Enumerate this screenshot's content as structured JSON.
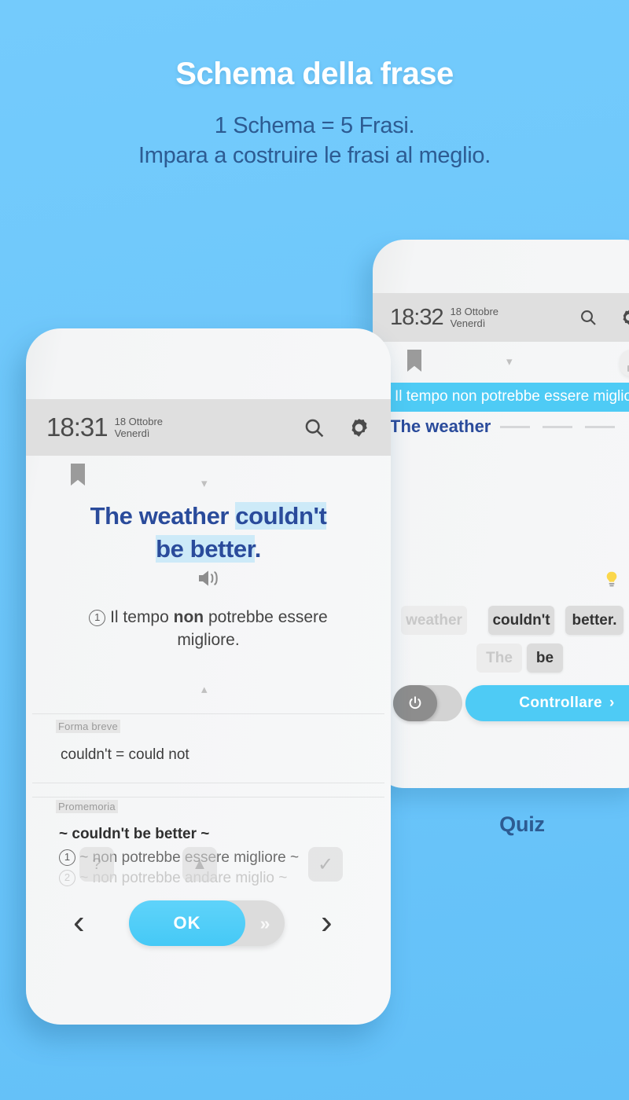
{
  "page": {
    "headline": "Schema della frase",
    "subline_1": "1 Schema = 5 Frasi.",
    "subline_2": "Impara a costruire le frasi al meglio.",
    "bg_color": "#6ec8fb",
    "accent_color": "#4ecbf5",
    "heading_text_color": "#ffffff",
    "sub_text_color": "#2d5b92"
  },
  "phone_front": {
    "status_bar": {
      "time": "18:31",
      "date_day": "18 Ottobre",
      "date_weekday": "Venerdì",
      "search_icon": "search-icon",
      "settings_icon": "gear-icon"
    },
    "bookmark_icon": "bookmark-icon",
    "collapse_icon": "chevron-down-icon",
    "sentence": {
      "plain_start": "The weather ",
      "highlight_1": "couldn't",
      "highlight_2": "be better",
      "period": ".",
      "text_color": "#2a4b9b",
      "highlight_color": "#cdeaf8"
    },
    "speaker_icon": "speaker-icon",
    "translation": {
      "number": "1",
      "part_1": "Il tempo ",
      "bold": "non",
      "part_2": " potrebbe essere migliore."
    },
    "expand_icon": "chevron-up-icon",
    "short_form_panel": {
      "label": "Forma breve",
      "body": "couldn't = could not"
    },
    "memo_panel": {
      "label": "Promemoria",
      "heading": "~ couldn't be better ~",
      "items": [
        {
          "number": "1",
          "text": "~ non potrebbe essere migliore ~"
        },
        {
          "number": "2",
          "text": "~ non potrebbe andare miglio ~"
        }
      ],
      "overlay_hint_icon": "question-mark-icon",
      "overlay_up_icon": "arrow-up-icon",
      "overlay_check_icon": "check-icon"
    },
    "bottom_nav": {
      "prev_label": "‹",
      "next_label": "›",
      "ok_label": "OK",
      "skip_label": "»"
    }
  },
  "phone_back": {
    "status_bar": {
      "time": "18:32",
      "date_day": "18 Ottobre",
      "date_weekday": "Venerdì",
      "search_icon": "search-icon",
      "settings_icon": "gear-icon"
    },
    "bookmark_icon": "bookmark-icon",
    "collapse_icon": "chevron-down-icon",
    "level_icon": "signal-level-icon",
    "quiz": {
      "prompt": "Il tempo non potrebbe essere migliore.",
      "answer_prefix": "The weather",
      "blank_count": 3,
      "delete_icon": "backspace-icon",
      "hint_icon": "lightbulb-icon",
      "chips_row_1": [
        {
          "label": "weather",
          "used": true
        },
        {
          "label": "couldn't",
          "used": false
        },
        {
          "label": "better.",
          "used": false
        }
      ],
      "chips_row_2": [
        {
          "label": "The",
          "used": true
        },
        {
          "label": "be",
          "used": false
        }
      ],
      "power_icon": "power-icon",
      "check_label": "Controllare",
      "check_arrow": "›"
    }
  },
  "captions": {
    "quiz": "Quiz"
  }
}
